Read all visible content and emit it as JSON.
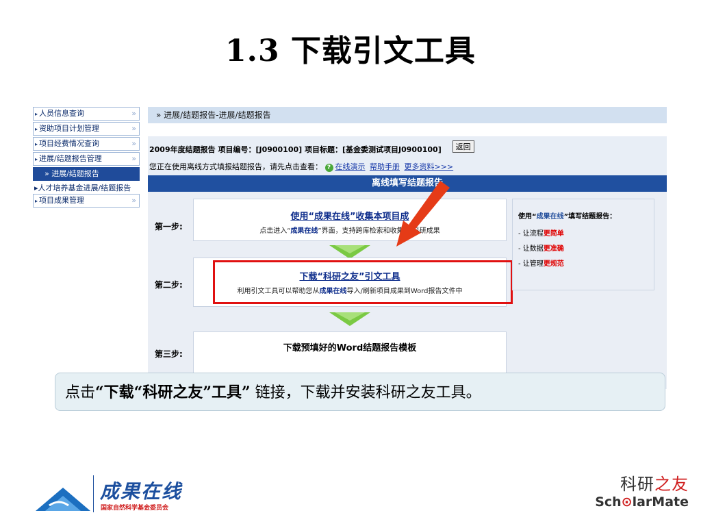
{
  "slide": {
    "title": "1.3 下载引文工具"
  },
  "sidebar": {
    "items": [
      {
        "label": "人员信息查询",
        "more": "»"
      },
      {
        "label": "资助项目计划管理",
        "more": "»"
      },
      {
        "label": "项目经费情况查询",
        "more": "»"
      },
      {
        "label": "进展/结题报告管理",
        "more": "»"
      }
    ],
    "active": "» 进展/结题报告",
    "sub": "人才培养基金进展/结题报告",
    "last": {
      "label": "项目成果管理",
      "more": "»"
    }
  },
  "breadcrumb": "» 进展/结题报告-进展/结题报告",
  "info": {
    "line1": "2009年度结题报告  项目编号：[J0900100]  项目标题：[基金委测试项目J0900100]",
    "back": "返回",
    "line2": "您正在使用离线方式填报结题报告，请先点击查看：",
    "links": [
      "在线演示",
      "帮助手册",
      "更多资料>>>"
    ]
  },
  "panel": {
    "title": "离线填写结题报告",
    "steps": [
      {
        "label": "第一步:",
        "title": "使用“成果在线”收集本项目成",
        "desc_pre": "点击进入“",
        "desc_bold": "成果在线",
        "desc_post": "”界面，支持跨库检索和收集    的科研成果"
      },
      {
        "label": "第二步:",
        "title": "下载“科研之友”引文工具",
        "desc_pre": "利用引文工具可以帮助您从",
        "desc_bold": "成果在线",
        "desc_post": "导入/刷新项目成果到Word报告文件中"
      },
      {
        "label": "第三步:",
        "title": "下载预填好的Word结题报告模板"
      }
    ],
    "side": {
      "heading_pre": "使用“",
      "heading_bold": "成果在线",
      "heading_post": "”填写结题报告：",
      "items": [
        {
          "pre": "- 让流程",
          "emph": "更简单"
        },
        {
          "pre": "- 让数据",
          "emph": "更准确"
        },
        {
          "pre": "- 让管理",
          "emph": "更规范"
        }
      ]
    }
  },
  "callout": {
    "pre": "点击",
    "bold": "“下载“科研之友”工具”",
    "post": " 链接，下载并安装科研之友工具。"
  },
  "logo_left": {
    "name": "成果在线",
    "sub": "国家自然科学基金委员会"
  },
  "logo_right": {
    "cn_a": "科研",
    "cn_b": "之友",
    "en_a": "Sch",
    "en_b": "larMate"
  },
  "colors": {
    "nav_active": "#1f4b9a",
    "highlight": "#e01010",
    "arrow": "#e53b17",
    "down_arrow": "#7ac943"
  }
}
